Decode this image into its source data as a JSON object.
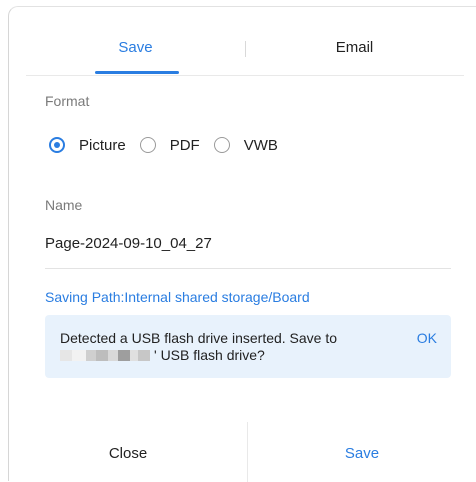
{
  "tabs": {
    "save_label": "Save",
    "email_label": "Email"
  },
  "format": {
    "label": "Format",
    "options": [
      "Picture",
      "PDF",
      "VWB"
    ],
    "selected": "Picture"
  },
  "name": {
    "label": "Name",
    "value": "Page-2024-09-10_04_27"
  },
  "saving_path": "Saving Path:Internal shared storage/Board",
  "usb_notice": {
    "line1": "Detected a USB flash drive inserted. Save to",
    "line2": "' USB flash drive?",
    "ok_label": "OK"
  },
  "footer": {
    "close_label": "Close",
    "save_label": "Save"
  },
  "colors": {
    "accent": "#2a7de1",
    "notice_bg": "#e8f2fc"
  }
}
